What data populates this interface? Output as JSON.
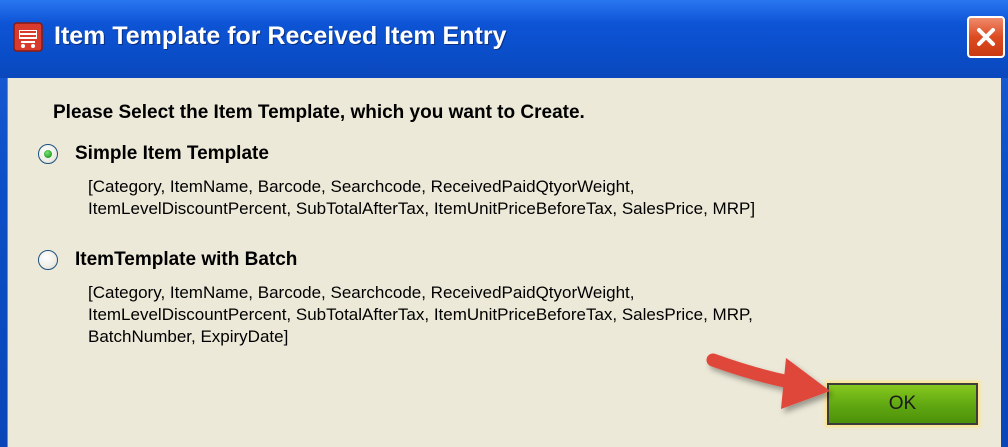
{
  "window": {
    "title": "Item Template for Received Item Entry",
    "accent": "#0a4dc8",
    "icon": "cart-icon",
    "close_icon": "close-icon"
  },
  "dialog": {
    "heading": "Please Select the Item Template, which you want to Create.",
    "options": [
      {
        "label": "Simple Item Template",
        "selected": true,
        "description_lines": [
          "[Category, ItemName, Barcode, Searchcode, ReceivedPaidQtyorWeight,",
          "ItemLevelDiscountPercent, SubTotalAfterTax, ItemUnitPriceBeforeTax, SalesPrice, MRP]"
        ]
      },
      {
        "label": "ItemTemplate with Batch",
        "selected": false,
        "description_lines": [
          "[Category, ItemName, Barcode, Searchcode, ReceivedPaidQtyorWeight,",
          "ItemLevelDiscountPercent, SubTotalAfterTax, ItemUnitPriceBeforeTax, SalesPrice, MRP,",
          "BatchNumber, ExpiryDate]"
        ]
      }
    ],
    "ok_label": "OK",
    "ok_color": "#5fa611",
    "annotation_arrow_color": "#e0463a"
  }
}
